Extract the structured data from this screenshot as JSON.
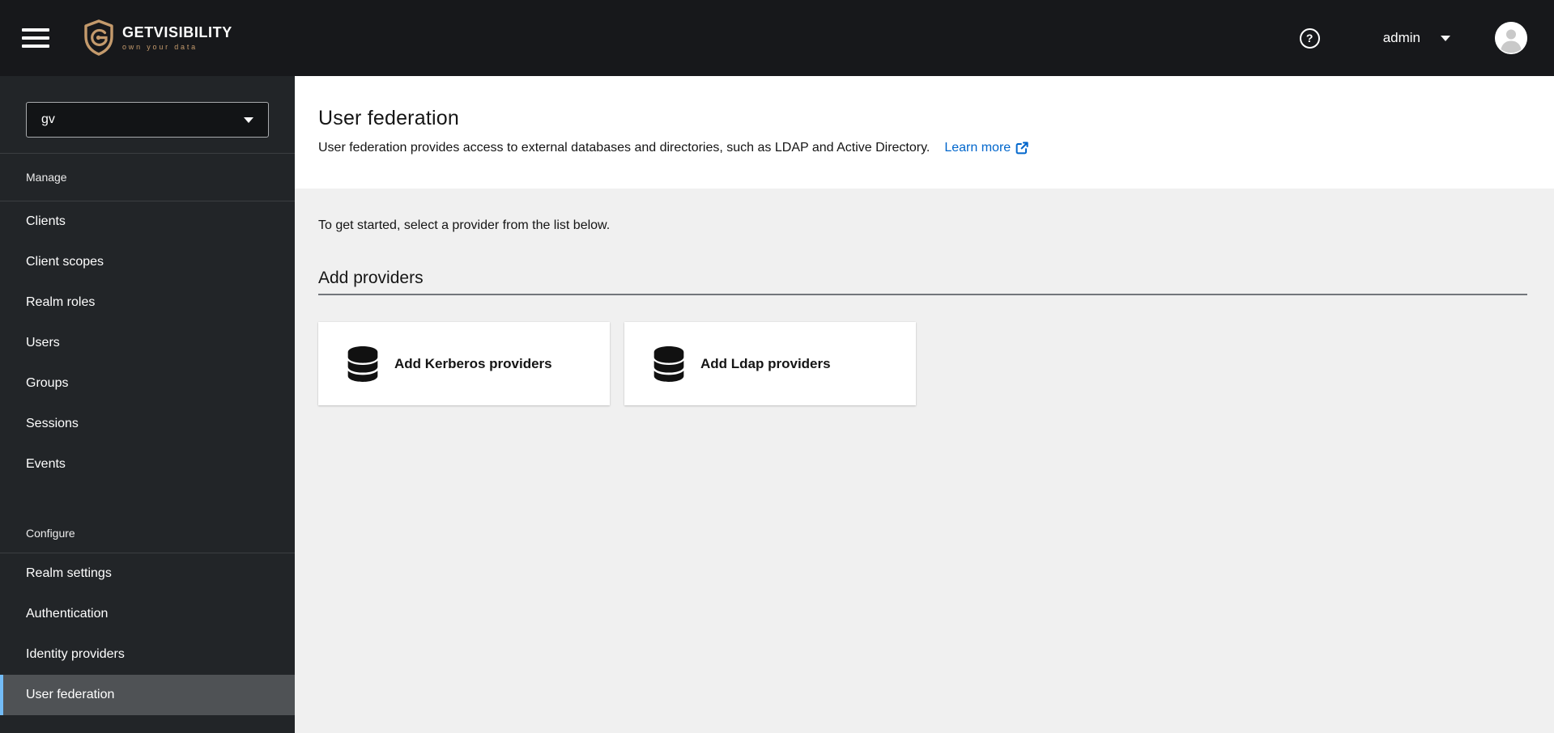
{
  "header": {
    "brand": {
      "name": "GETVISIBILITY",
      "tagline": "own your data"
    },
    "help_label": "?",
    "user": {
      "name": "admin"
    }
  },
  "sidebar": {
    "realm_selector": {
      "value": "gv"
    },
    "sections": [
      {
        "label": "Manage",
        "items": [
          "Clients",
          "Client scopes",
          "Realm roles",
          "Users",
          "Groups",
          "Sessions",
          "Events"
        ]
      },
      {
        "label": "Configure",
        "items": [
          "Realm settings",
          "Authentication",
          "Identity providers",
          "User federation"
        ],
        "selected_item": "User federation"
      }
    ]
  },
  "main": {
    "title": "User federation",
    "description": "User federation provides access to external databases and directories, such as LDAP and Active Directory.",
    "learn_more_label": "Learn more",
    "intro": "To get started, select a provider from the list below.",
    "section_title": "Add providers",
    "providers": [
      {
        "label": "Add Kerberos providers",
        "icon": "database-icon"
      },
      {
        "label": "Add Ldap providers",
        "icon": "database-icon"
      }
    ]
  },
  "colors": {
    "brand_accent": "#c49a6c",
    "link_blue": "#0066cc",
    "nav_selected_indicator": "#73bcf7",
    "masthead_bg": "#17181b",
    "sidebar_bg": "#222528",
    "content_bg": "#f0f0f0"
  }
}
